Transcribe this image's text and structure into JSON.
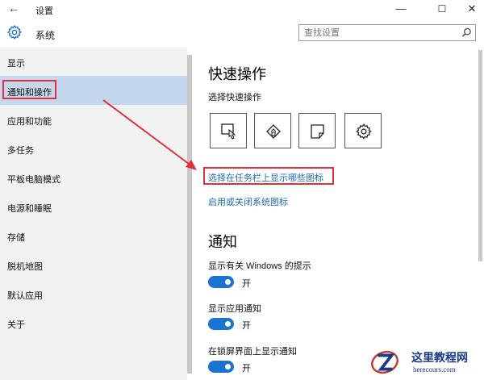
{
  "window": {
    "title": "设置",
    "back_glyph": "←",
    "minimize_glyph": "—",
    "maximize_glyph": "☐",
    "close_glyph": "✕"
  },
  "header": {
    "title": "系统",
    "icon": "gear-icon"
  },
  "search": {
    "placeholder": "查找设置",
    "icon": "search-icon"
  },
  "sidebar": {
    "items": [
      {
        "label": "显示"
      },
      {
        "label": "通知和操作",
        "selected": true
      },
      {
        "label": "应用和功能"
      },
      {
        "label": "多任务"
      },
      {
        "label": "平板电脑模式"
      },
      {
        "label": "电源和睡眠"
      },
      {
        "label": "存储"
      },
      {
        "label": "脱机地图"
      },
      {
        "label": "默认应用"
      },
      {
        "label": "关于"
      }
    ]
  },
  "main": {
    "quick_actions_title": "快速操作",
    "quick_actions_subtitle": "选择快速操作",
    "quick_action_tiles": [
      "tablet-mode-icon",
      "network-icon",
      "note-icon",
      "settings-icon"
    ],
    "link_taskbar_icons": "选择在任务栏上显示哪些图标",
    "link_system_icons": "启用或关闭系统图标",
    "notifications_title": "通知",
    "settings": [
      {
        "label": "显示有关 Windows 的提示",
        "state": "开",
        "on": true
      },
      {
        "label": "显示应用通知",
        "state": "开",
        "on": true
      },
      {
        "label": "在锁屏界面上显示通知",
        "state": "开",
        "on": true
      }
    ]
  },
  "watermark": {
    "text": "这里教程网",
    "url": "herecours.com"
  },
  "colors": {
    "accent": "#1a73d1",
    "link": "#1d6bb8",
    "selection": "#c3d8ef",
    "annotation": "#e0303a",
    "sidebar_bg": "#f2f2f2"
  }
}
